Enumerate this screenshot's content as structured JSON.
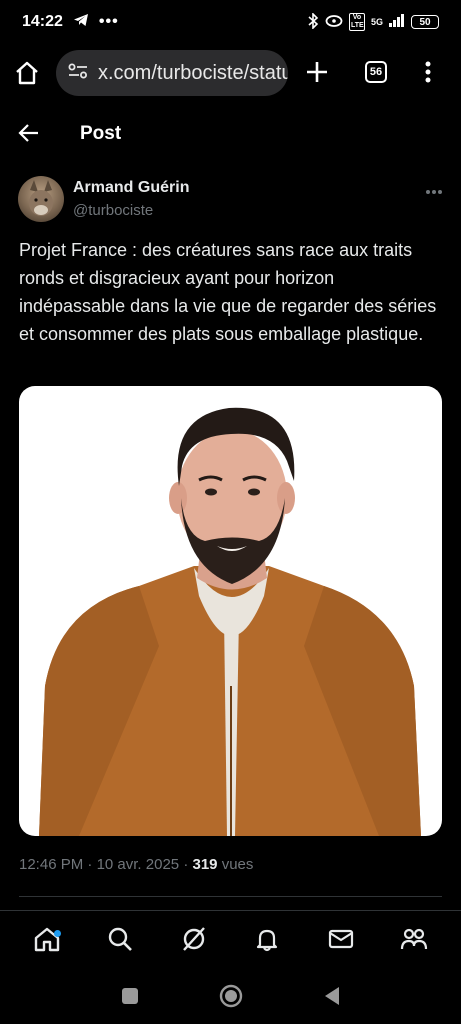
{
  "status_bar": {
    "time": "14:22",
    "network": "5G",
    "volte": "Vo LTE",
    "battery": "50"
  },
  "browser": {
    "url": "x.com/turbociste/status",
    "tab_count": "56"
  },
  "header": {
    "title": "Post"
  },
  "author": {
    "name": "Armand Guérin",
    "handle": "@turbociste"
  },
  "tweet": {
    "text": "Projet France : des créatures sans race aux traits ronds et disgracieux ayant pour horizon indépassable dans la vie que de regarder des séries et consommer des plats sous emballage plastique."
  },
  "meta": {
    "time": "12:46 PM",
    "separator": "·",
    "date": "10 avr. 2025",
    "views_count": "319",
    "views_label": "vues"
  },
  "colors": {
    "background": "#000000",
    "accent": "#1d9bf0",
    "muted": "#71767b",
    "jacket": "#b36a2b"
  },
  "icons": {
    "home": "home-icon",
    "search": "search-icon",
    "grok": "grok-icon",
    "notifications": "bell-icon",
    "messages": "mail-icon",
    "communities": "people-icon"
  }
}
